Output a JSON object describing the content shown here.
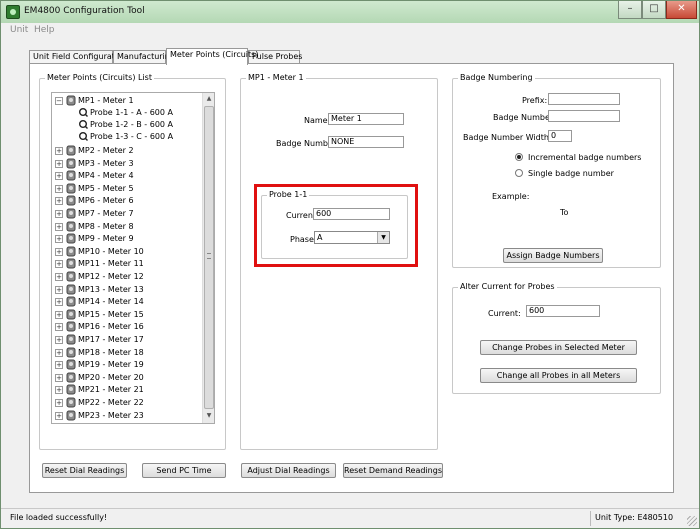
{
  "window": {
    "title": "EM4800 Configuration Tool",
    "controls": {
      "minimize": "–",
      "maximize": "□",
      "close": "✕"
    }
  },
  "menu": [
    "Unit",
    "Help"
  ],
  "tabs": [
    "Unit Field Configuration",
    "Manufacturing",
    "Meter Points (Circuits)",
    "Pulse Probes"
  ],
  "meter_list": {
    "title": "Meter Points (Circuits) List",
    "expanded_meter": "MP1 - Meter 1",
    "probes": [
      "Probe 1-1 - A - 600 A",
      "Probe 1-2 - B - 600 A",
      "Probe 1-3 - C - 600 A"
    ],
    "meters": [
      "MP2 - Meter 2",
      "MP3 - Meter 3",
      "MP4 - Meter 4",
      "MP5 - Meter 5",
      "MP6 - Meter 6",
      "MP7 - Meter 7",
      "MP8 - Meter 8",
      "MP9 - Meter 9",
      "MP10 - Meter 10",
      "MP11 - Meter 11",
      "MP12 - Meter 12",
      "MP13 - Meter 13",
      "MP14 - Meter 14",
      "MP15 - Meter 15",
      "MP16 - Meter 16",
      "MP17 - Meter 17",
      "MP18 - Meter 18",
      "MP19 - Meter 19",
      "MP20 - Meter 20",
      "MP21 - Meter 21",
      "MP22 - Meter 22",
      "MP23 - Meter 23"
    ]
  },
  "meter_detail": {
    "title": "MP1 - Meter 1",
    "name_label": "Name:",
    "name_value": "Meter 1",
    "badge_label": "Badge Number:",
    "badge_value": "NONE",
    "probe": {
      "title": "Probe 1-1",
      "current_label": "Current:",
      "current_value": "600",
      "phase_label": "Phase:",
      "phase_value": "A"
    }
  },
  "badge_numbering": {
    "title": "Badge Numbering",
    "prefix_label": "Prefix:",
    "prefix_value": "",
    "badge_number_label": "Badge Number:",
    "badge_number_value": "",
    "width_label": "Badge Number Width:",
    "width_value": "0",
    "radio_incremental": "Incremental badge numbers",
    "radio_single": "Single badge number",
    "selected_mode": "incremental",
    "example_label": "Example:",
    "to_label": "To",
    "assign_button": "Assign Badge Numbers"
  },
  "alter_current": {
    "title": "Alter Current for Probes",
    "current_label": "Current:",
    "current_value": "600",
    "change_selected_button": "Change Probes in Selected Meter",
    "change_all_button": "Change all Probes in all Meters"
  },
  "bottom_buttons": [
    "Reset Dial Readings",
    "Send PC Time",
    "Adjust Dial Readings",
    "Reset Demand Readings"
  ],
  "status": {
    "message": "File loaded successfully!",
    "unit_type": "Unit Type: E480510"
  },
  "colors": {
    "titlebar": "#b4d8b4",
    "highlight": "#e01010"
  }
}
